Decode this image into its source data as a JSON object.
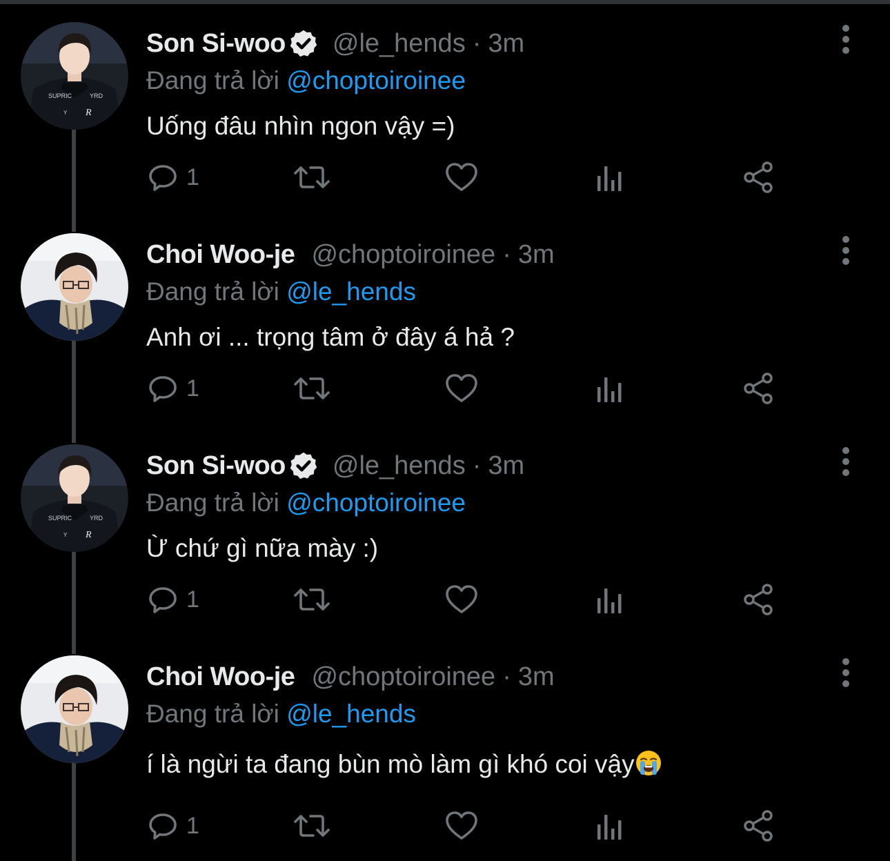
{
  "theme": {
    "background": "#000000",
    "text": "#e7e9ea",
    "muted": "#71767b",
    "accent": "#1d9bf0",
    "thread_line": "#3e4144"
  },
  "tweets": [
    {
      "name": "Son Si-woo",
      "verified": true,
      "handle": "@le_hends",
      "separator": "·",
      "time": "3m",
      "reply_prefix": "Đang trả lời",
      "reply_to": "@choptoiroinee",
      "text": "Uống đâu nhìn ngon vậy =)",
      "emoji": null,
      "reply_count": "1",
      "avatar": "avatar-son-si-woo"
    },
    {
      "name": "Choi Woo-je",
      "verified": false,
      "handle": "@choptoiroinee",
      "separator": "·",
      "time": "3m",
      "reply_prefix": "Đang trả lời",
      "reply_to": "@le_hends",
      "text": "Anh ơi ... trọng tâm ở đây á hả ?",
      "emoji": null,
      "reply_count": "1",
      "avatar": "avatar-choi-woo-je"
    },
    {
      "name": "Son Si-woo",
      "verified": true,
      "handle": "@le_hends",
      "separator": "·",
      "time": "3m",
      "reply_prefix": "Đang trả lời",
      "reply_to": "@choptoiroinee",
      "text": "Ừ chứ gì nữa mày :)",
      "emoji": null,
      "reply_count": "1",
      "avatar": "avatar-son-si-woo"
    },
    {
      "name": "Choi Woo-je",
      "verified": false,
      "handle": "@choptoiroinee",
      "separator": "·",
      "time": "3m",
      "reply_prefix": "Đang trả lời",
      "reply_to": "@le_hends",
      "text": "í là ngừi ta đang bùn mò làm gì khó coi vậy",
      "emoji": "loudly-crying-face-emoji",
      "reply_count": "1",
      "avatar": "avatar-choi-woo-je"
    }
  ],
  "icons": {
    "reply": "reply-icon",
    "retweet": "retweet-icon",
    "like": "heart-icon",
    "views": "analytics-icon",
    "share": "share-icon",
    "more": "more-vertical-icon",
    "verified": "verified-badge-icon"
  }
}
